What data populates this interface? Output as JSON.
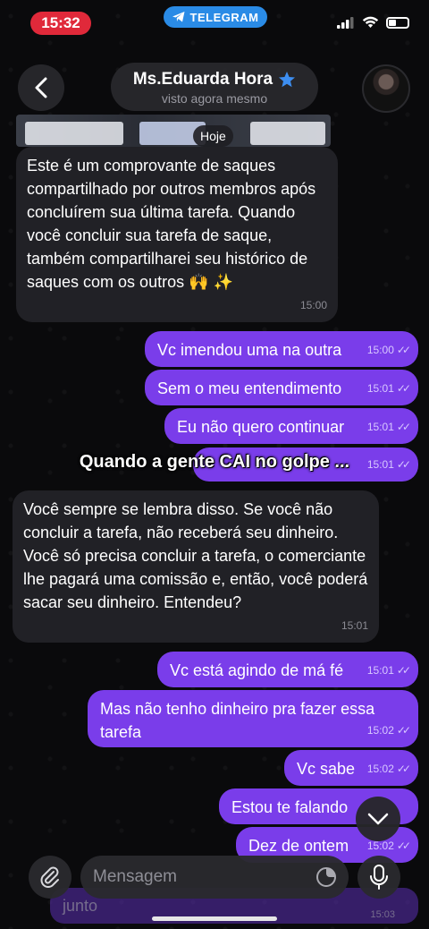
{
  "status_bar": {
    "time": "15:32",
    "app_pill": "TELEGRAM"
  },
  "header": {
    "name": "Ms.Eduarda Hora",
    "status": "visto agora mesmo",
    "verified_icon": "star-badge-icon"
  },
  "date_chip": "Hoje",
  "overlay_caption": "Quando a gente CAI no golpe ...",
  "messages": [
    {
      "side": "in",
      "text": "Este é um comprovante de saques compartilhado por outros membros após concluírem sua última tarefa. Quando você concluir sua tarefa de saque, também compartilharei seu histórico de saques com os outros 🙌 ✨",
      "time": "15:00"
    },
    {
      "side": "out",
      "text": "Vc imendou uma na outra",
      "time": "15:00"
    },
    {
      "side": "out",
      "text": "Sem o meu entendimento",
      "time": "15:01"
    },
    {
      "side": "out",
      "text": "Eu não quero continuar",
      "time": "15:01"
    },
    {
      "side": "out",
      "text": "",
      "time": "15:01"
    },
    {
      "side": "in",
      "text": "Você sempre se lembra disso. Se você não concluir a tarefa, não receberá seu dinheiro. Você só precisa concluir a tarefa, o comerciante lhe pagará uma comissão e, então, você poderá sacar seu dinheiro. Entendeu?",
      "time": "15:01"
    },
    {
      "side": "out",
      "text": "Vc está agindo de má fé",
      "time": "15:01"
    },
    {
      "side": "out",
      "text": "Mas não tenho dinheiro pra fazer essa tarefa",
      "time": "15:02"
    },
    {
      "side": "out",
      "text": "Vc sabe",
      "time": "15:02"
    },
    {
      "side": "out",
      "text": "Estou te falando",
      "time": ""
    },
    {
      "side": "out",
      "text": "Dez de ontem",
      "time": "15:02"
    },
    {
      "side": "out",
      "text": "junto",
      "time": "15:03"
    }
  ],
  "composer": {
    "placeholder": "Mensagem"
  },
  "colors": {
    "outgoing": "#7a3dea",
    "incoming": "#212126",
    "background": "#0a0a0c",
    "recording_pill": "#e0293a",
    "telegram_pill": "#2a8be6"
  }
}
